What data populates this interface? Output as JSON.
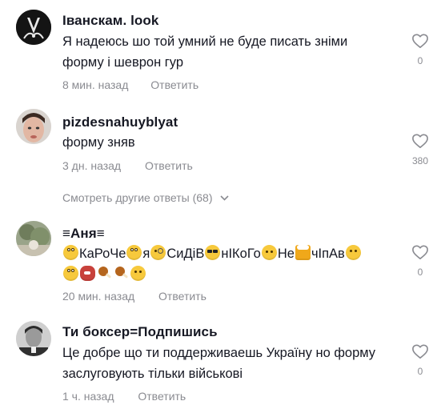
{
  "comments": [
    {
      "username": "Іванскам. look",
      "text_lines": [
        "Я надеюсь шо той умний не буде писать зніми",
        "форму і шеврон гур"
      ],
      "time": "8 мин. назад",
      "reply_label": "Ответить",
      "likes": "0"
    },
    {
      "username": "pizdesnahuyblyat",
      "text_lines": [
        "форму зняв"
      ],
      "time": "3 дн. назад",
      "reply_label": "Ответить",
      "likes": "380"
    },
    {
      "username": "≡Аня≡",
      "text_parts": [
        "КаРоЧе",
        "я",
        "СиДіВ",
        "нІКоГо",
        "Не",
        "чІпАв"
      ],
      "time": "20 мин. назад",
      "reply_label": "Ответить",
      "likes": "0"
    },
    {
      "username": "Ти боксер=Подпишись",
      "text_lines": [
        "Це добре що ти поддерживаешь Україну но форму",
        "заслуговують тільки військові"
      ],
      "time": "1 ч. назад",
      "reply_label": "Ответить",
      "likes": "0"
    }
  ],
  "view_more_label": "Смотреть другие ответы (68)",
  "icons": {
    "like": "heart-outline-icon",
    "expand": "chevron-down-icon"
  },
  "colors": {
    "text": "#161823",
    "secondary": "#8a8b91",
    "background": "#ffffff"
  }
}
